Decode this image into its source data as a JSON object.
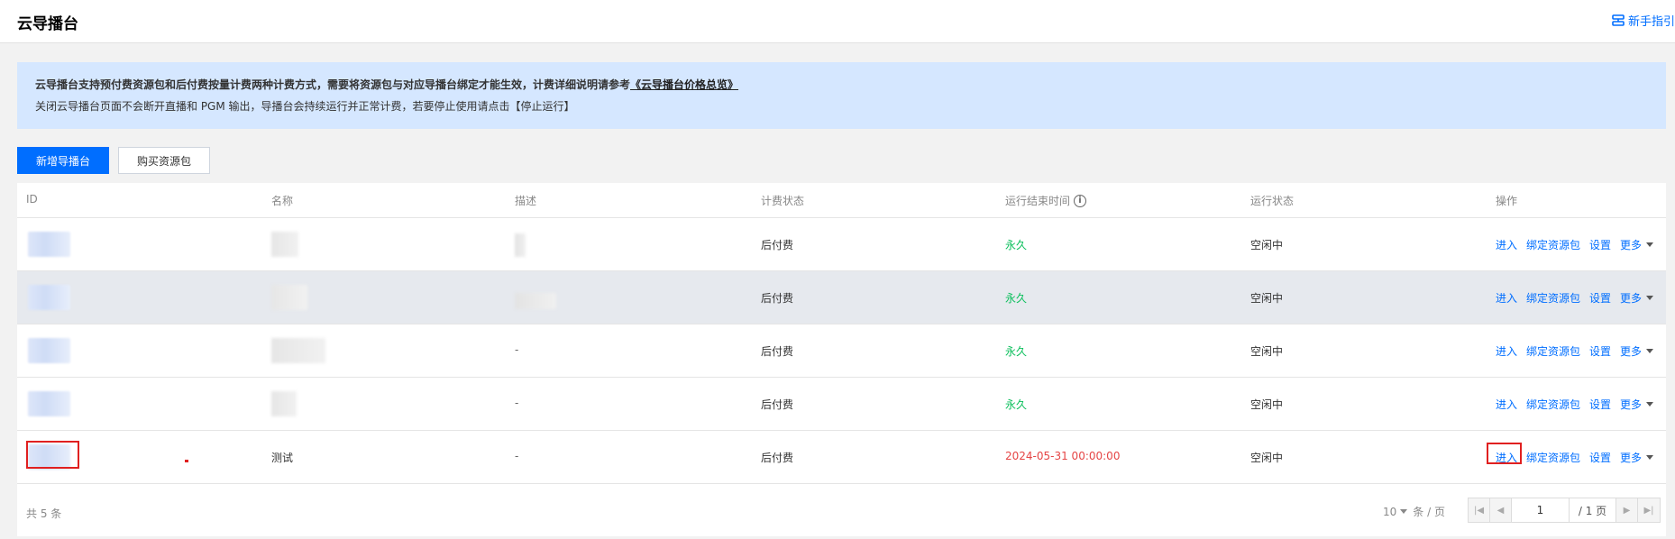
{
  "header": {
    "title": "云导播台",
    "guide_label": "新手指引"
  },
  "notice": {
    "line1_text": "云导播台支持预付费资源包和后付费按量计费两种计费方式，需要将资源包与对应导播台绑定才能生效，计费详细说明请参考",
    "line1_link": "《云导播台价格总览》",
    "line2_text": "关闭云导播台页面不会断开直播和 PGM 输出，导播台会持续运行并正常计费，若要停止使用请点击【停止运行】"
  },
  "toolbar": {
    "new_label": "新增导播台",
    "buy_label": "购买资源包"
  },
  "table": {
    "columns": [
      "ID",
      "名称",
      "描述",
      "计费状态",
      "运行结束时间",
      "运行状态",
      "操作"
    ],
    "rows": [
      {
        "name": "",
        "desc": "",
        "billing": "后付费",
        "end_time": "永久",
        "status": "空闲中",
        "end_color": "green"
      },
      {
        "name": "",
        "desc": "",
        "billing": "后付费",
        "end_time": "永久",
        "status": "空闲中",
        "end_color": "green"
      },
      {
        "name": "",
        "desc": "-",
        "billing": "后付费",
        "end_time": "永久",
        "status": "空闲中",
        "end_color": "green"
      },
      {
        "name": "",
        "desc": "-",
        "billing": "后付费",
        "end_time": "永久",
        "status": "空闲中",
        "end_color": "green"
      },
      {
        "name": "测试",
        "desc": "-",
        "billing": "后付费",
        "end_time": "2024-05-31 00:00:00",
        "status": "空闲中",
        "end_color": "red"
      }
    ],
    "actions": {
      "enter": "进入",
      "bind": "绑定资源包",
      "settings": "设置",
      "more": "更多"
    }
  },
  "footer": {
    "total": "共 5 条",
    "page_size": "10",
    "page_size_unit": "条 / 页",
    "current_page": "1",
    "total_pages": "/ 1 页"
  },
  "colors": {
    "accent": "#006eff",
    "notice_bg": "#d5e7ff",
    "green": "#0abf5b",
    "red": "#e54545"
  }
}
